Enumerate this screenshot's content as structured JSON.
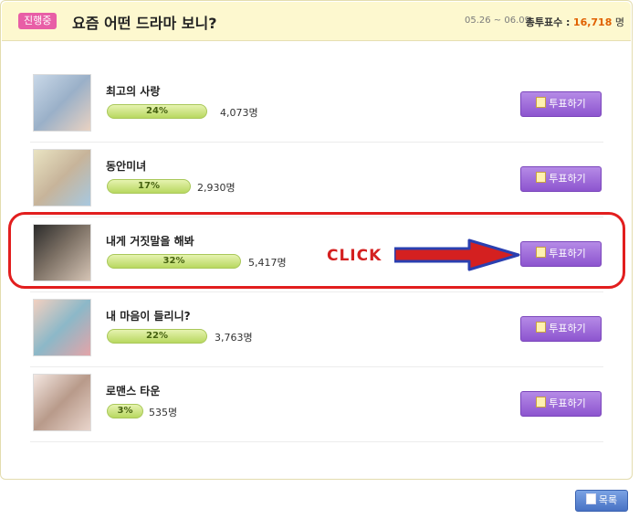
{
  "header": {
    "status_badge": "진행중",
    "title": "요즘 어떤 드라마 보니?",
    "period": "05.26 ~ 06.09",
    "total_label": "총투표수 :",
    "total_value": "16,718",
    "total_unit": "명"
  },
  "items": [
    {
      "name": "최고의 사랑",
      "percent": "24%",
      "votes": "4,073명",
      "vote_label": "투표하기"
    },
    {
      "name": "동안미녀",
      "percent": "17%",
      "votes": "2,930명",
      "vote_label": "투표하기"
    },
    {
      "name": "내게 거짓말을 해봐",
      "percent": "32%",
      "votes": "5,417명",
      "vote_label": "투표하기"
    },
    {
      "name": "내 마음이 들리니?",
      "percent": "22%",
      "votes": "3,763명",
      "vote_label": "투표하기"
    },
    {
      "name": "로맨스 타운",
      "percent": "3%",
      "votes": "535명",
      "vote_label": "투표하기"
    }
  ],
  "annotation": {
    "label": "CLICK"
  },
  "footer": {
    "list_label": "목록"
  },
  "colors": {
    "accent_purple": "#8d55cf",
    "progress_green": "#b8d860",
    "annotation_red": "#d42020",
    "total_orange": "#e06000"
  }
}
